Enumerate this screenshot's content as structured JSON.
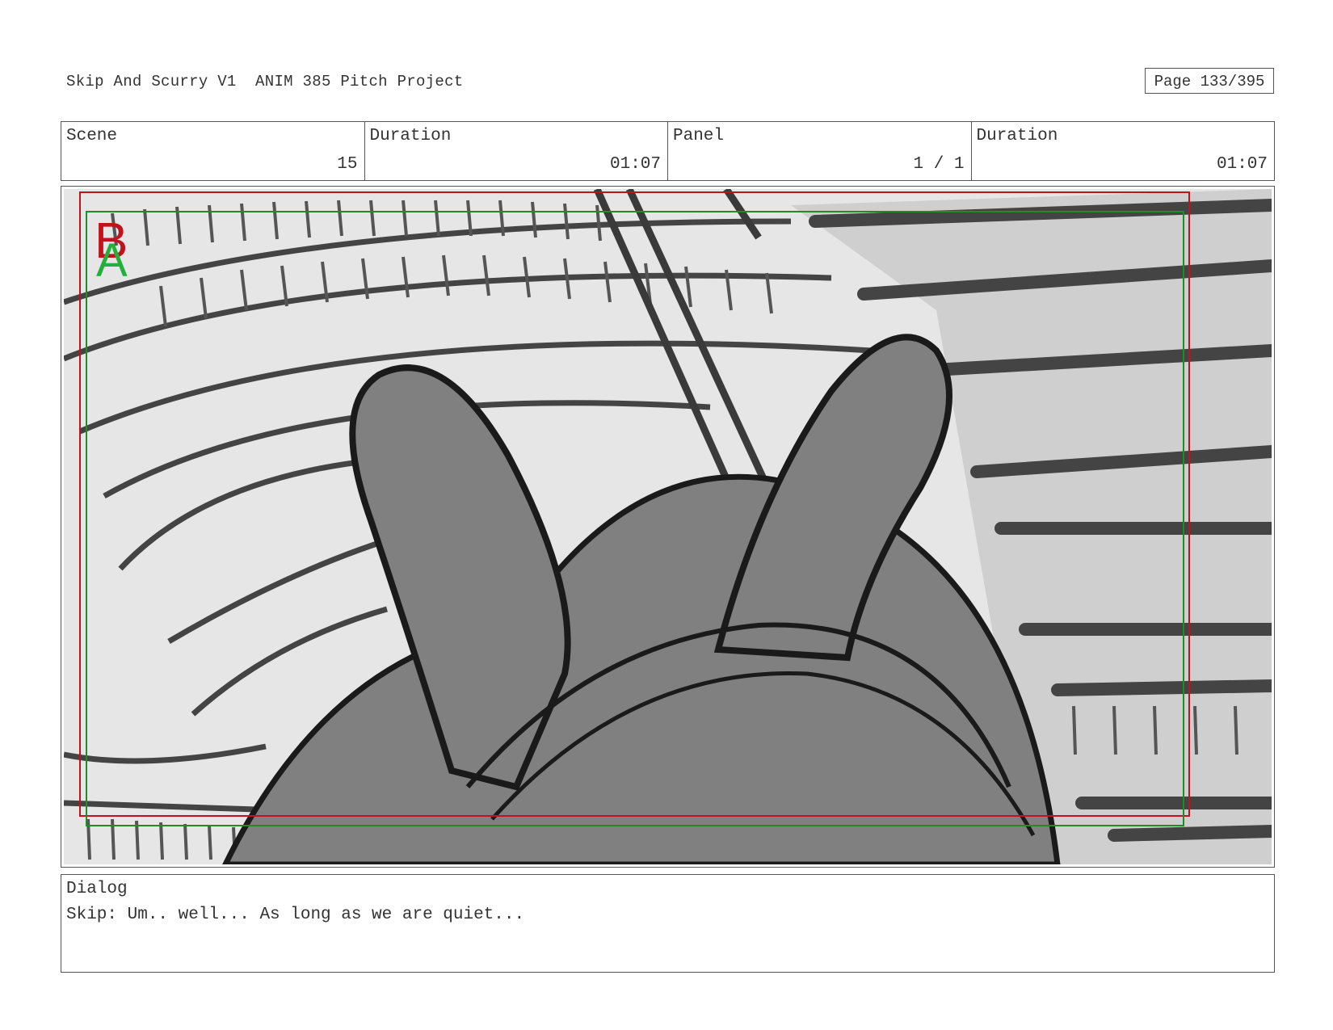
{
  "header": {
    "title": "Skip And Scurry V1  ANIM 385 Pitch Project",
    "page": "Page 133/395"
  },
  "info": {
    "scene_label": "Scene",
    "scene_value": "15",
    "duration_label": "Duration",
    "duration_value": "01:07",
    "panel_label": "Panel",
    "panel_value": "1 / 1",
    "panel_duration_label": "Duration",
    "panel_duration_value": "01:07"
  },
  "panel": {
    "safe_frame_b_label": "B",
    "safe_frame_a_label": "A",
    "frame_b_color": "#c0131e",
    "frame_a_color": "#1e8c2a",
    "character_fill": "#808080"
  },
  "dialog": {
    "label": "Dialog",
    "text": "Skip: Um.. well... As long as we are quiet..."
  }
}
